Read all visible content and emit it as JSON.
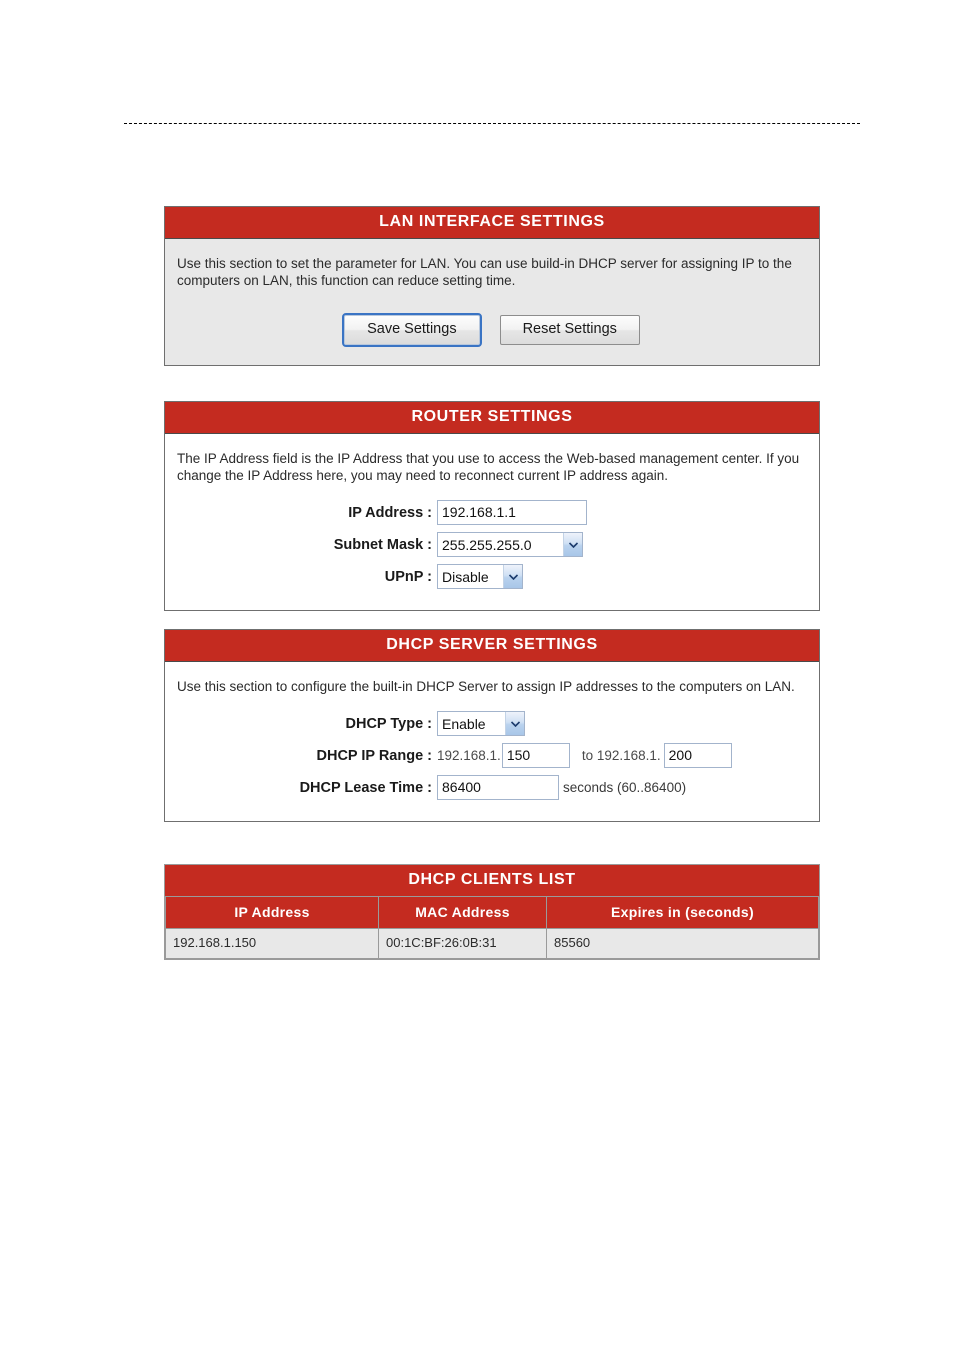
{
  "page": {
    "divider": "dashed-rule"
  },
  "lan_interface": {
    "header": "LAN INTERFACE SETTINGS",
    "description": "Use this section to set the parameter for LAN. You can use build-in DHCP server for assigning IP to the computers on LAN, this function can reduce setting time.",
    "save_label": "Save Settings",
    "reset_label": "Reset Settings"
  },
  "router_settings": {
    "header": "ROUTER SETTINGS",
    "description": "The IP Address field is the IP Address that you use to access the Web-based management center. If you change the IP Address here, you may need to reconnect current IP address again.",
    "ip_address": {
      "label": "IP Address :",
      "value": "192.168.1.1"
    },
    "subnet_mask": {
      "label": "Subnet Mask :",
      "value": "255.255.255.0"
    },
    "upnp": {
      "label": "UPnP :",
      "value": "Disable"
    }
  },
  "dhcp_server": {
    "header": "DHCP SERVER SETTINGS",
    "description": "Use this section to configure the built-in DHCP Server to assign IP addresses to the computers on LAN.",
    "dhcp_type": {
      "label": "DHCP Type :",
      "value": "Enable"
    },
    "dhcp_ip_range": {
      "label": "DHCP IP Range :",
      "start_prefix": "192.168.1.",
      "start_value": "150",
      "separator": "to 192.168.1.",
      "end_value": "200"
    },
    "dhcp_lease_time": {
      "label": "DHCP Lease Time :",
      "value": "86400",
      "suffix": "seconds (60..86400)"
    }
  },
  "dhcp_clients": {
    "header": "DHCP CLIENTS LIST",
    "columns": [
      "IP Address",
      "MAC Address",
      "Expires in (seconds)"
    ],
    "rows": [
      {
        "ip_address": "192.168.1.150",
        "mac_address": "00:1C:BF:26:0B:31",
        "expires_in": "85560"
      }
    ]
  },
  "colors": {
    "header_red": "#c42b20",
    "panel_gray": "#e8e8e8",
    "focus_blue": "#3a74c4"
  }
}
